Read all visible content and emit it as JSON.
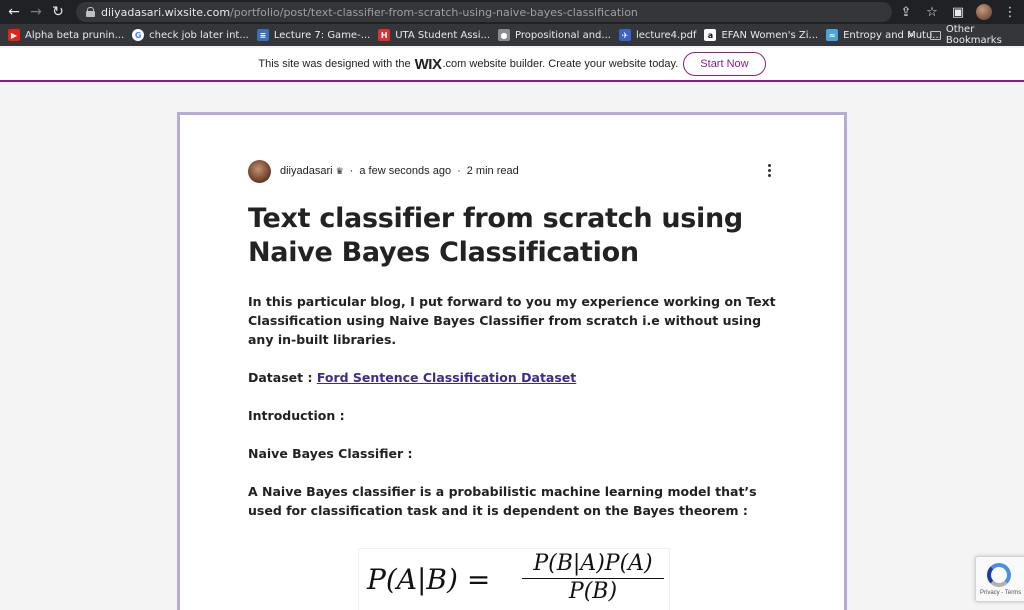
{
  "browser": {
    "url_host": "diiyadasari.wixsite.com",
    "url_path": "/portfolio/post/text-classifier-from-scratch-using-naive-bayes-classification"
  },
  "bookmarks": [
    {
      "label": "Alpha beta prunin...",
      "icon": "youtube-icon",
      "color": "#e62117"
    },
    {
      "label": "check job later int...",
      "icon": "google-icon",
      "color": "#4285f4"
    },
    {
      "label": "Lecture 7: Game-...",
      "icon": "lecture-icon",
      "color": "#3b6fb6"
    },
    {
      "label": "UTA Student Assi...",
      "icon": "h-icon",
      "color": "#e02f2f"
    },
    {
      "label": "Propositional and...",
      "icon": "globe-icon",
      "color": "#8a8d91"
    },
    {
      "label": "lecture4.pdf",
      "icon": "bird-icon",
      "color": "#3b63c4"
    },
    {
      "label": "EFAN Women's Zi...",
      "icon": "a-icon",
      "color": "#ffffff"
    },
    {
      "label": "Entropy and Mutu...",
      "icon": "stack-icon",
      "color": "#4aa3df"
    }
  ],
  "bookmarks_more": "»",
  "other_bookmarks": "Other Bookmarks",
  "wix_banner": {
    "text_before": "This site was designed with the",
    "logo": "WIX",
    "text_after": ".com website builder. Create your website today.",
    "button": "Start Now"
  },
  "post": {
    "author": "diiyadasari",
    "time": "a few seconds ago",
    "read_time": "2 min read",
    "separator": "·",
    "title": "Text classifier from scratch using Naive Bayes Classification",
    "intro": "In this particular blog, I put forward to you my experience working on Text Classification using Naive Bayes Classifier from scratch i.e without using any in-built libraries.",
    "dataset_label": "Dataset : ",
    "dataset_link": "Ford Sentence Classification Dataset",
    "introduction_heading": "Introduction :",
    "nb_heading": "Naive Bayes Classifier :",
    "nb_text": "A Naive Bayes classifier is a probabilistic machine learning model that’s used for classification task and it is dependent on the Bayes theorem :",
    "formula_lhs": "P(A|B) =",
    "formula_num": "P(B|A)P(A)",
    "formula_den": "P(B)"
  },
  "recaptcha": {
    "text": "Privacy - Terms"
  }
}
